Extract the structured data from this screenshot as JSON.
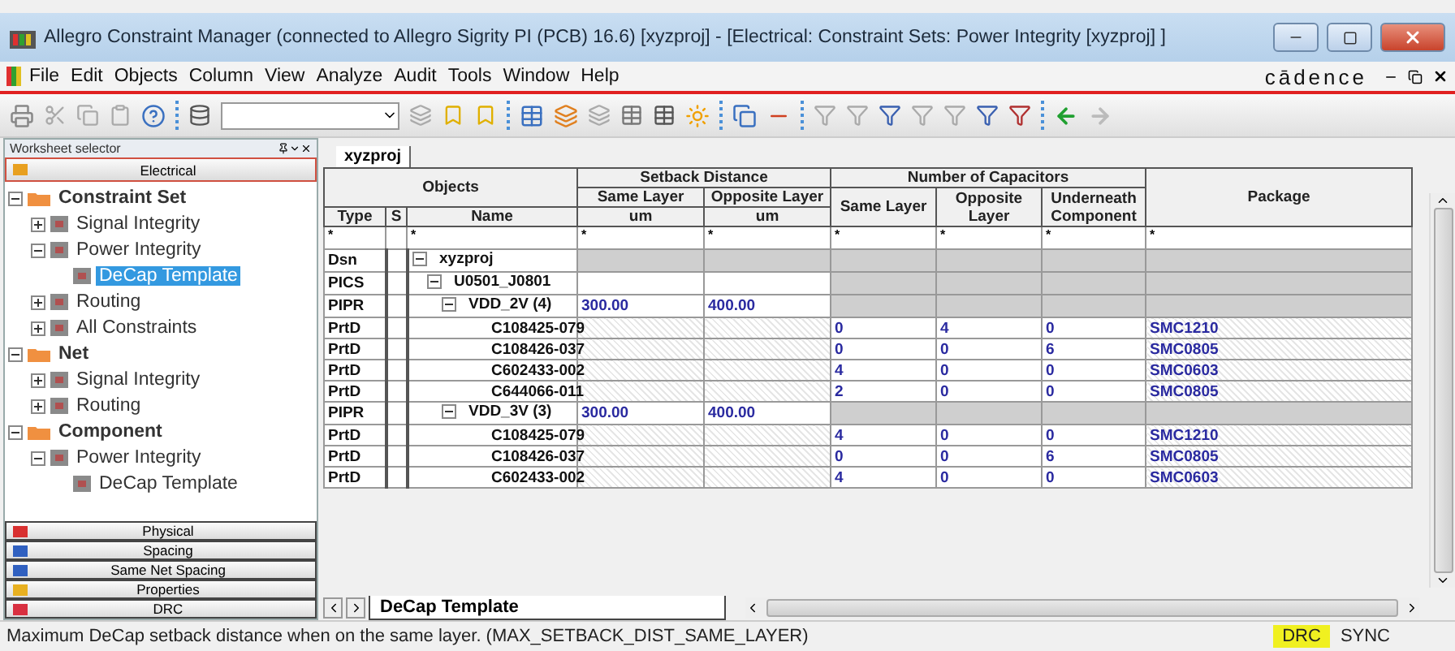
{
  "window": {
    "title": "Allegro Constraint Manager (connected to Allegro Sigrity PI (PCB) 16.6) [xyzproj] - [Electrical:  Constraint Sets:  Power Integrity [xyzproj] ]"
  },
  "menu": [
    "File",
    "Edit",
    "Objects",
    "Column",
    "View",
    "Analyze",
    "Audit",
    "Tools",
    "Window",
    "Help"
  ],
  "logo": "cādence",
  "sidebar": {
    "title": "Worksheet selector",
    "categories_top": [
      {
        "label": "Electrical",
        "selected": true,
        "color": "#e8a020"
      }
    ],
    "tree": [
      {
        "label": "Constraint Set",
        "kind": "folder",
        "expanded": true,
        "selected": false,
        "children": [
          {
            "label": "Signal Integrity",
            "kind": "sheet",
            "expanded": false,
            "selected": false
          },
          {
            "label": "Power Integrity",
            "kind": "sheet",
            "expanded": true,
            "selected": false,
            "children": [
              {
                "label": "DeCap Template",
                "kind": "sheet",
                "selected": true
              }
            ]
          },
          {
            "label": "Routing",
            "kind": "sheet",
            "expanded": false,
            "selected": false
          },
          {
            "label": "All Constraints",
            "kind": "sheet",
            "expanded": false,
            "selected": false
          }
        ]
      },
      {
        "label": "Net",
        "kind": "folder",
        "expanded": true,
        "selected": false,
        "children": [
          {
            "label": "Signal Integrity",
            "kind": "sheet",
            "expanded": false,
            "selected": false
          },
          {
            "label": "Routing",
            "kind": "sheet",
            "expanded": false,
            "selected": false
          }
        ]
      },
      {
        "label": "Component",
        "kind": "folder",
        "expanded": true,
        "selected": false,
        "children": [
          {
            "label": "Power Integrity",
            "kind": "sheet",
            "expanded": true,
            "selected": false,
            "children": [
              {
                "label": "DeCap Template",
                "kind": "sheet",
                "selected": false
              }
            ]
          }
        ]
      }
    ],
    "categories_bottom": [
      {
        "label": "Physical",
        "selected": false,
        "color": "#d83030"
      },
      {
        "label": "Spacing",
        "selected": false,
        "color": "#3060c0"
      },
      {
        "label": "Same Net Spacing",
        "selected": false,
        "color": "#3060c0"
      },
      {
        "label": "Properties",
        "selected": false,
        "color": "#e8b020"
      },
      {
        "label": "DRC",
        "selected": false,
        "color": "#d83040"
      }
    ]
  },
  "workbook_tab": "xyzproj",
  "table": {
    "group_headers": [
      "Objects",
      "Setback Distance",
      "Number of Capacitors",
      "Package"
    ],
    "sub_headers": [
      "Same Layer",
      "Opposite Layer",
      "Same Layer",
      "Opposite Layer",
      "Underneath Component"
    ],
    "column_headers": [
      "Type",
      "S",
      "Name"
    ],
    "units": [
      "um",
      "um"
    ],
    "filter": {
      "type": "*",
      "name": "*",
      "values": [
        "*",
        "*",
        "*",
        "*",
        "*",
        "*"
      ]
    },
    "rows": [
      {
        "type": "Dsn",
        "name": "xyzproj",
        "kind": "design",
        "expanded": true,
        "children": [
          {
            "type": "PICS",
            "name": "U0501_J0801",
            "kind": "set",
            "expanded": true,
            "children": [
              {
                "type": "PIPR",
                "name": "VDD_2V (4)",
                "kind": "net",
                "expanded": true,
                "values": [
                  "300.00",
                  "400.00"
                ],
                "children": [
                  {
                    "type": "PrtD",
                    "name": "C108425-079",
                    "kind": "part",
                    "values": [
                      "0",
                      "4",
                      "0",
                      "SMC1210"
                    ]
                  },
                  {
                    "type": "PrtD",
                    "name": "C108426-037",
                    "kind": "part",
                    "values": [
                      "0",
                      "0",
                      "6",
                      "SMC0805"
                    ]
                  },
                  {
                    "type": "PrtD",
                    "name": "C602433-002",
                    "kind": "part",
                    "values": [
                      "4",
                      "0",
                      "0",
                      "SMC0603"
                    ]
                  },
                  {
                    "type": "PrtD",
                    "name": "C644066-011",
                    "kind": "part",
                    "values": [
                      "2",
                      "0",
                      "0",
                      "SMC0805"
                    ]
                  }
                ]
              },
              {
                "type": "PIPR",
                "name": "VDD_3V (3)",
                "kind": "net",
                "expanded": true,
                "values": [
                  "300.00",
                  "400.00"
                ],
                "children": [
                  {
                    "type": "PrtD",
                    "name": "C108425-079",
                    "kind": "part",
                    "values": [
                      "4",
                      "0",
                      "0",
                      "SMC1210"
                    ]
                  },
                  {
                    "type": "PrtD",
                    "name": "C108426-037",
                    "kind": "part",
                    "values": [
                      "0",
                      "0",
                      "6",
                      "SMC0805"
                    ]
                  },
                  {
                    "type": "PrtD",
                    "name": "C602433-002",
                    "kind": "part",
                    "values": [
                      "4",
                      "0",
                      "0",
                      "SMC0603"
                    ]
                  }
                ]
              }
            ]
          }
        ]
      }
    ]
  },
  "sheet_tabs": [
    {
      "label": "DeCap Template",
      "selected": true
    }
  ],
  "status_bar": {
    "message": "Maximum DeCap setback distance when on the same layer. (MAX_SETBACK_DIST_SAME_LAYER)",
    "indicators": [
      {
        "label": "DRC",
        "on": true
      },
      {
        "label": "SYNC",
        "on": false
      }
    ]
  }
}
